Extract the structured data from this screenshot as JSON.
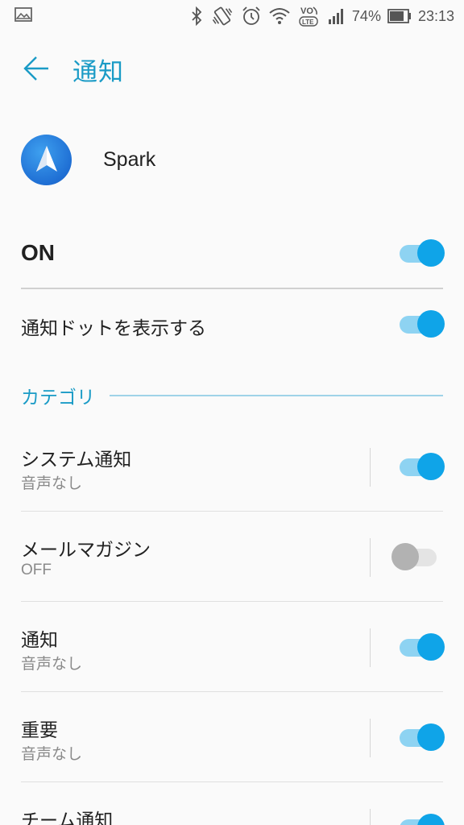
{
  "status_bar": {
    "battery_percent": "74%",
    "time": "23:13",
    "volte_top": "VO",
    "volte_bottom": "LTE",
    "icons": [
      "image-icon",
      "bluetooth-icon",
      "vibrate-icon",
      "alarm-icon",
      "wifi-icon",
      "volte-icon",
      "signal-icon",
      "battery-icon"
    ]
  },
  "header": {
    "title": "通知"
  },
  "app": {
    "name": "Spark"
  },
  "master": {
    "label": "ON",
    "enabled": true
  },
  "dot": {
    "label": "通知ドットを表示する",
    "enabled": true
  },
  "category": {
    "label": "カテゴリ"
  },
  "categories": [
    {
      "title": "システム通知",
      "subtitle": "音声なし",
      "enabled": true
    },
    {
      "title": "メールマガジン",
      "subtitle": "OFF",
      "enabled": false
    },
    {
      "title": "通知",
      "subtitle": "音声なし",
      "enabled": true
    },
    {
      "title": "重要",
      "subtitle": "音声なし",
      "enabled": true
    },
    {
      "title": "チーム通知",
      "subtitle": "",
      "enabled": true
    }
  ],
  "colors": {
    "accent": "#1a9bc6",
    "toggle_on_thumb": "#0fa4e8",
    "toggle_on_track": "#8ed3f2",
    "toggle_off_thumb": "#b2b2b2"
  }
}
